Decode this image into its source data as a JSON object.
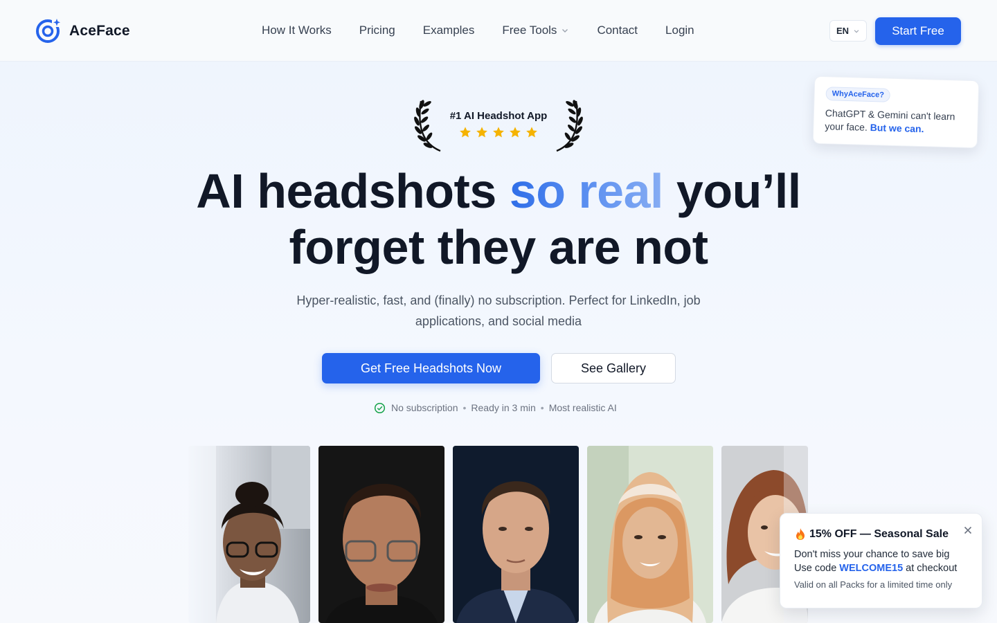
{
  "header": {
    "brand": "AceFace",
    "nav": [
      {
        "label": "How It Works"
      },
      {
        "label": "Pricing"
      },
      {
        "label": "Examples"
      },
      {
        "label": "Free Tools",
        "has_dropdown": true
      },
      {
        "label": "Contact"
      },
      {
        "label": "Login"
      }
    ],
    "language": "EN",
    "cta": "Start Free"
  },
  "why_card": {
    "badge": "WhyAceFace?",
    "text": "ChatGPT & Gemini can't learn your face.",
    "accent": "But we can."
  },
  "award": {
    "title": "#1 AI Headshot App",
    "rating_stars": 5
  },
  "hero": {
    "title_part1": "AI headshots",
    "title_highlight": "so real",
    "title_part2": "you’ll forget they are not",
    "subtitle": "Hyper-realistic, fast, and (finally) no subscription. Perfect for LinkedIn, job applications, and social media",
    "primary_cta": "Get Free Headshots Now",
    "secondary_cta": "See Gallery",
    "features": [
      "No subscription",
      "Ready in 3 min",
      "Most realistic AI"
    ]
  },
  "gallery": {
    "photos": [
      "headshot-woman-glasses",
      "headshot-man-glasses",
      "headshot-man-suit",
      "headshot-woman-hijab",
      "headshot-woman-redhair"
    ]
  },
  "promo": {
    "icon": "fire-emoji",
    "title": "15% OFF — Seasonal Sale",
    "line1": "Don't miss your chance to save big",
    "line2_prefix": "Use code",
    "code": "WELCOME15",
    "line2_suffix": "at checkout",
    "note": "Valid on all Packs for a limited time only"
  },
  "colors": {
    "accent": "#2563eb",
    "text": "#111827",
    "star": "#f5b301",
    "check": "#16a34a"
  }
}
